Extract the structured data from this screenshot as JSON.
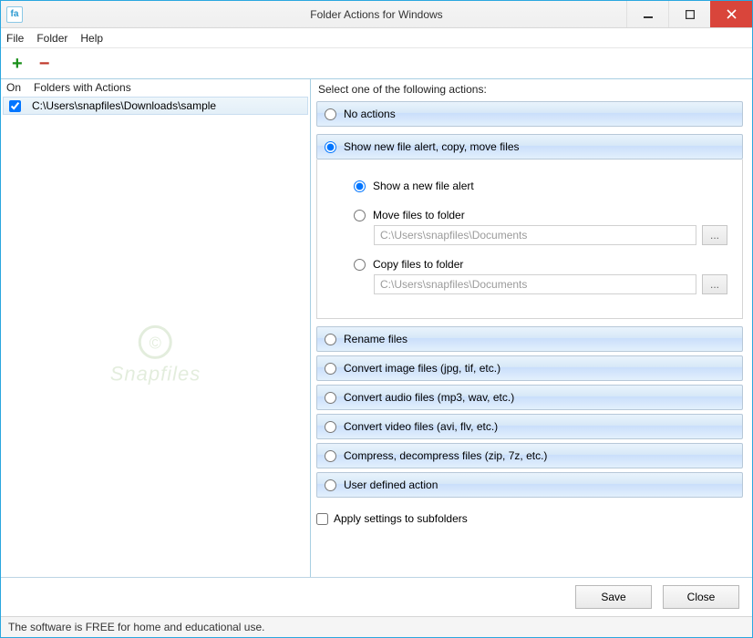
{
  "window": {
    "title": "Folder Actions for Windows",
    "app_icon_text": "fa"
  },
  "menu": {
    "file": "File",
    "folder": "Folder",
    "help": "Help"
  },
  "toolbar": {
    "add": "+",
    "remove": "−"
  },
  "left": {
    "col_on": "On",
    "col_folders": "Folders with Actions",
    "items": [
      {
        "checked": true,
        "path": "C:\\Users\\snapfiles\\Downloads\\sample"
      }
    ]
  },
  "right": {
    "select_label": "Select one of the following actions:",
    "options": {
      "none": "No actions",
      "alert_copy_move": "Show new file alert, copy, move files",
      "rename": "Rename files",
      "convert_image": "Convert image files (jpg, tif, etc.)",
      "convert_audio": "Convert audio files (mp3, wav, etc.)",
      "convert_video": "Convert video files (avi, flv, etc.)",
      "compress": "Compress, decompress files (zip, 7z, etc.)",
      "user_defined": "User defined action"
    },
    "sub": {
      "show_alert": "Show a new file alert",
      "move_to": "Move files to folder",
      "copy_to": "Copy files to folder",
      "move_path": "C:\\Users\\snapfiles\\Documents",
      "copy_path": "C:\\Users\\snapfiles\\Documents",
      "browse": "..."
    },
    "apply_subfolders": "Apply settings to subfolders"
  },
  "footer": {
    "save": "Save",
    "close": "Close"
  },
  "status": "The software is FREE for home and educational use.",
  "watermark": "Snapfiles"
}
